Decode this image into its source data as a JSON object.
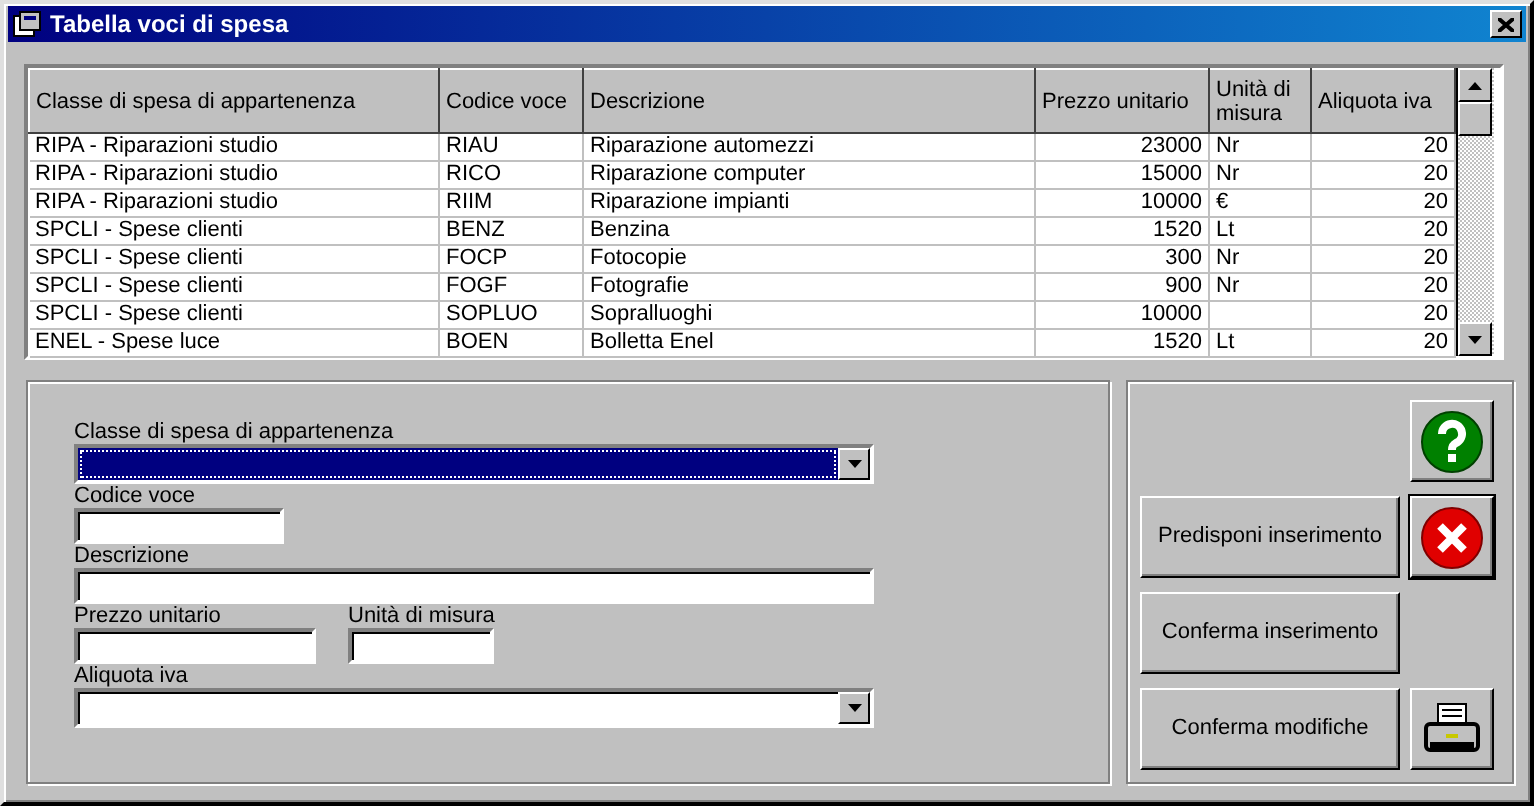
{
  "window": {
    "title": "Tabella voci di spesa"
  },
  "table": {
    "columns": [
      "Classe di spesa di appartenenza",
      "Codice voce",
      "Descrizione",
      "Prezzo unitario",
      "Unità di misura",
      "Aliquota iva"
    ],
    "rows": [
      [
        "RIPA - Riparazioni studio",
        "RIAU",
        "Riparazione automezzi",
        "23000",
        "Nr",
        "20"
      ],
      [
        "RIPA - Riparazioni studio",
        "RICO",
        "Riparazione computer",
        "15000",
        "Nr",
        "20"
      ],
      [
        "RIPA - Riparazioni studio",
        "RIIM",
        "Riparazione impianti",
        "10000",
        "€",
        "20"
      ],
      [
        "SPCLI - Spese clienti",
        "BENZ",
        "Benzina",
        "1520",
        "Lt",
        "20"
      ],
      [
        "SPCLI - Spese clienti",
        "FOCP",
        "Fotocopie",
        "300",
        "Nr",
        "20"
      ],
      [
        "SPCLI - Spese clienti",
        "FOGF",
        "Fotografie",
        "900",
        "Nr",
        "20"
      ],
      [
        "SPCLI - Spese clienti",
        "SOPLUO",
        "Sopralluoghi",
        "10000",
        "",
        "20"
      ],
      [
        "ENEL - Spese luce",
        "BOEN",
        "Bolletta Enel",
        "1520",
        "Lt",
        "20"
      ]
    ]
  },
  "form": {
    "rows": [
      [
        {
          "kind": "combo",
          "label": "Classe di spesa di appartenenza",
          "focused": true
        }
      ],
      [
        {
          "kind": "text",
          "label": "Codice voce",
          "focused": false
        }
      ],
      [
        {
          "kind": "text",
          "label": "Descrizione",
          "focused": false
        }
      ],
      [
        {
          "kind": "text",
          "label": "Prezzo unitario",
          "focused": false
        },
        {
          "kind": "text",
          "label": "Unità di misura",
          "focused": false
        }
      ],
      [
        {
          "kind": "combo",
          "label": "Aliquota iva",
          "focused": false
        }
      ]
    ]
  },
  "command_buttons": [
    "Predisponi inserimento",
    "Conferma inserimento",
    "Conferma modifiche"
  ],
  "tool_buttons": [
    {
      "kind": "help",
      "default": false
    },
    {
      "kind": "cancel",
      "default": true
    },
    {
      "kind": "print",
      "default": false
    }
  ]
}
